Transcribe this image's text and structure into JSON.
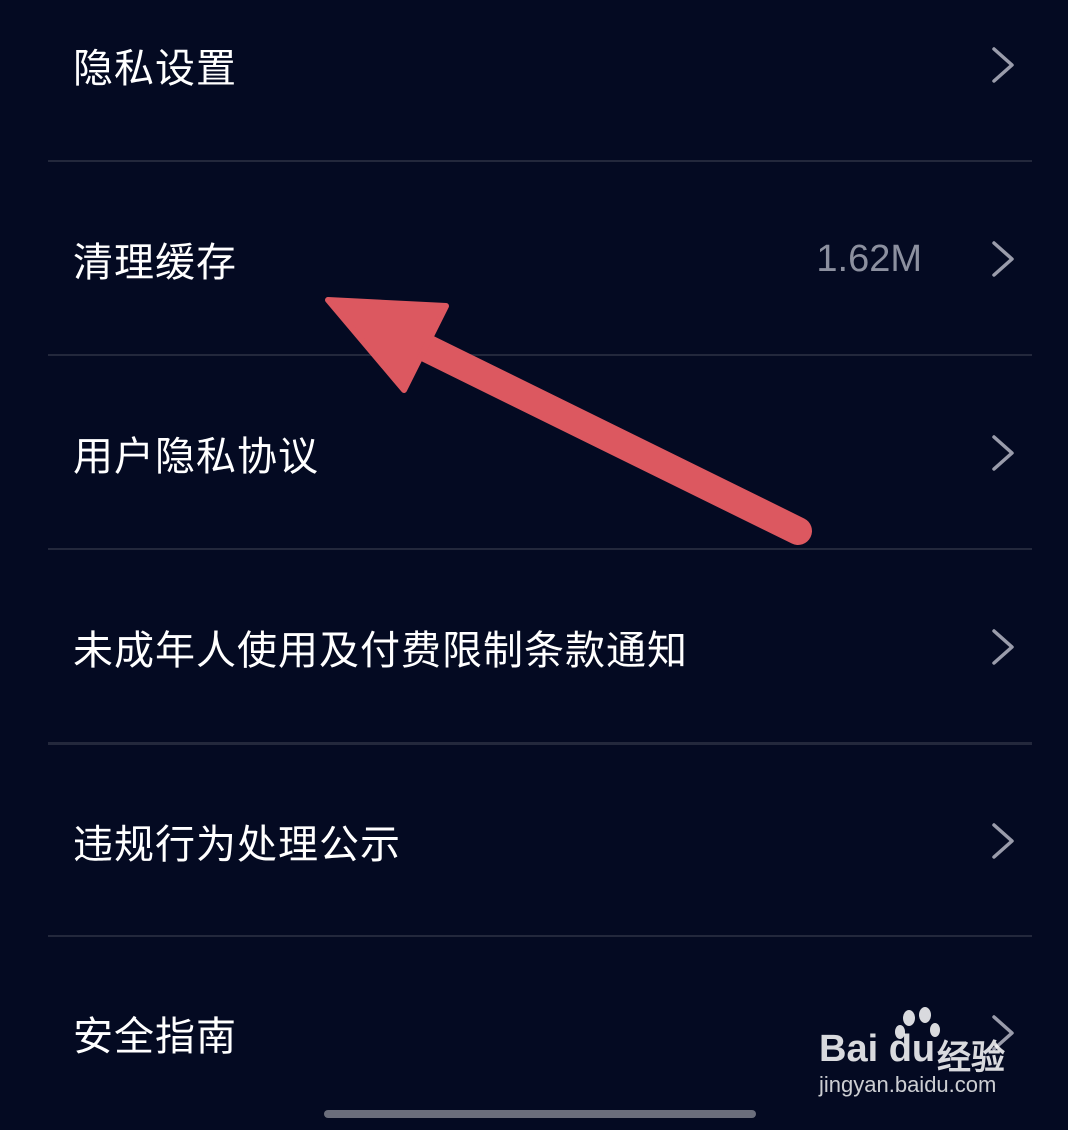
{
  "settings": {
    "items": [
      {
        "label": "隐私设置",
        "value": ""
      },
      {
        "label": "清理缓存",
        "value": "1.62M"
      },
      {
        "label": "用户隐私协议",
        "value": ""
      },
      {
        "label": "未成年人使用及付费限制条款通知",
        "value": ""
      },
      {
        "label": "违规行为处理公示",
        "value": ""
      },
      {
        "label": "安全指南",
        "value": ""
      }
    ]
  },
  "watermark": {
    "brand": "Bai du",
    "cn": "经验",
    "url": "jingyan.baidu.com"
  },
  "colors": {
    "background": "#040a22",
    "divider": "#23283c",
    "chevron": "#9a9cab",
    "annotation_arrow": "#dc5860"
  },
  "icons": {
    "chevron": "chevron-right-icon",
    "arrow": "annotation-arrow-icon",
    "paw": "baidu-paw-icon"
  }
}
